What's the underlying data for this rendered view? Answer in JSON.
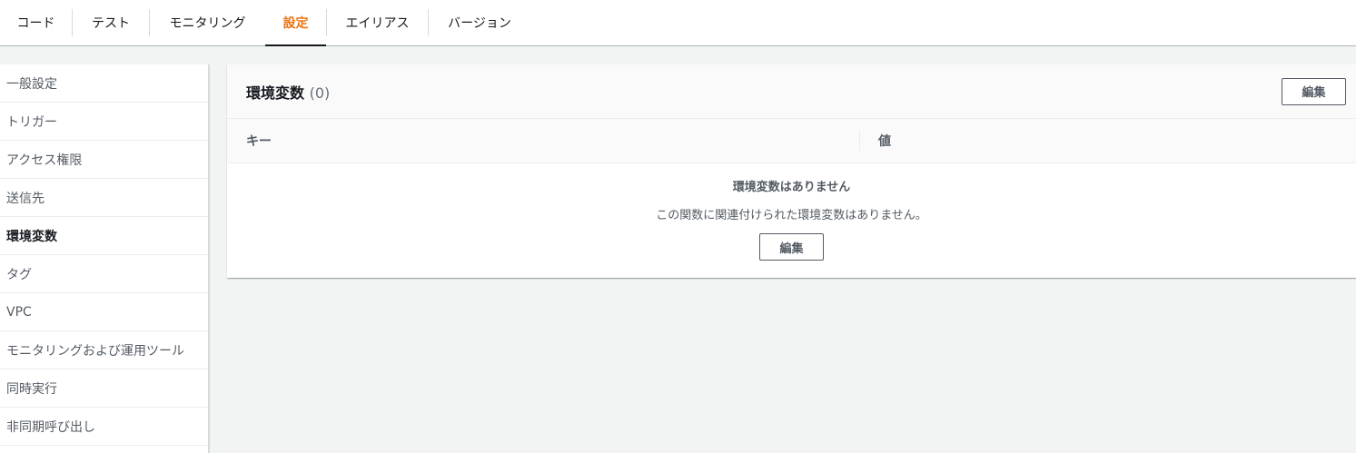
{
  "tabs": [
    {
      "label": "コード",
      "active": false
    },
    {
      "label": "テスト",
      "active": false
    },
    {
      "label": "モニタリング",
      "active": false
    },
    {
      "label": "設定",
      "active": true
    },
    {
      "label": "エイリアス",
      "active": false
    },
    {
      "label": "バージョン",
      "active": false
    }
  ],
  "sidebar": {
    "items": [
      {
        "label": "一般設定",
        "active": false
      },
      {
        "label": "トリガー",
        "active": false
      },
      {
        "label": "アクセス権限",
        "active": false
      },
      {
        "label": "送信先",
        "active": false
      },
      {
        "label": "環境変数",
        "active": true
      },
      {
        "label": "タグ",
        "active": false
      },
      {
        "label": "VPC",
        "active": false
      },
      {
        "label": "モニタリングおよび運用ツール",
        "active": false
      },
      {
        "label": "同時実行",
        "active": false
      },
      {
        "label": "非同期呼び出し",
        "active": false
      }
    ]
  },
  "panel": {
    "title": "環境変数",
    "count": "(0)",
    "edit_label": "編集",
    "columns": {
      "key": "キー",
      "value": "値"
    },
    "empty": {
      "title": "環境変数はありません",
      "description": "この関数に関連付けられた環境変数はありません。",
      "edit_label": "編集"
    }
  },
  "colors": {
    "accent": "#ec7211",
    "background": "#f2f3f3",
    "text": "#16191f"
  }
}
